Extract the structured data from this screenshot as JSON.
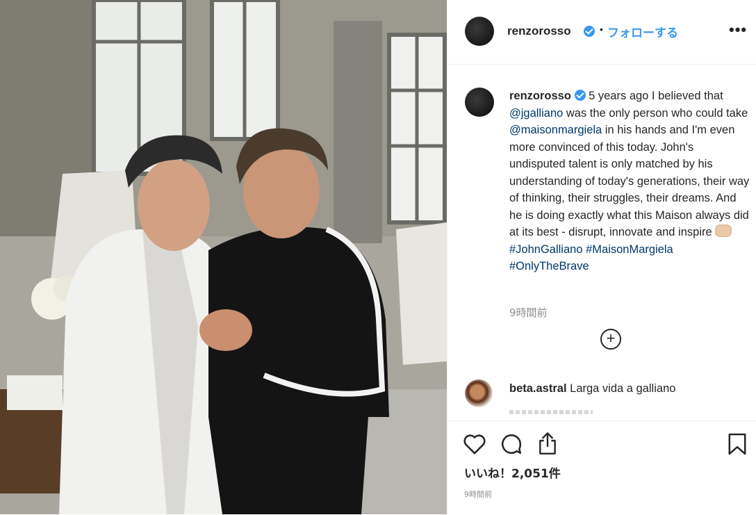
{
  "post": {
    "photo_description": "",
    "header": {
      "username": "renzorosso",
      "separator": "•",
      "follow_label": "フォローする",
      "more_label": "•••"
    },
    "caption": {
      "username": "renzorosso",
      "parts": {
        "p1": "5 years ago I believed that ",
        "mention1": "@jgalliano",
        "p2": " was the only person who could take ",
        "mention2": "@maisonmargiela",
        "p3": " in his hands and I'm even more convinced of this today. John's undisputed talent is only matched by his understanding of today's generations, their way of thinking, their struggles, their dreams. And he is doing exactly what this Maison always did at its best - disrupt, innovate and inspire ",
        "tag1": "#JohnGalliano",
        "tag2": "#MaisonMargiela",
        "tag3": "#OnlyTheBrave"
      },
      "time": "9時間前"
    },
    "load_more_label": "+",
    "comment": {
      "username": "beta.astral",
      "text": "Larga vida a galliano"
    },
    "likes": "いいね！2,051件",
    "time": "9時間前",
    "colors": {
      "accent": "#3897f0",
      "link": "#00376b",
      "muted": "#8e8e8e",
      "text": "#262626"
    },
    "icons": [
      "heart-icon",
      "comment-icon",
      "share-icon",
      "bookmark-icon",
      "verified-badge-icon",
      "plus-circle-icon"
    ]
  }
}
